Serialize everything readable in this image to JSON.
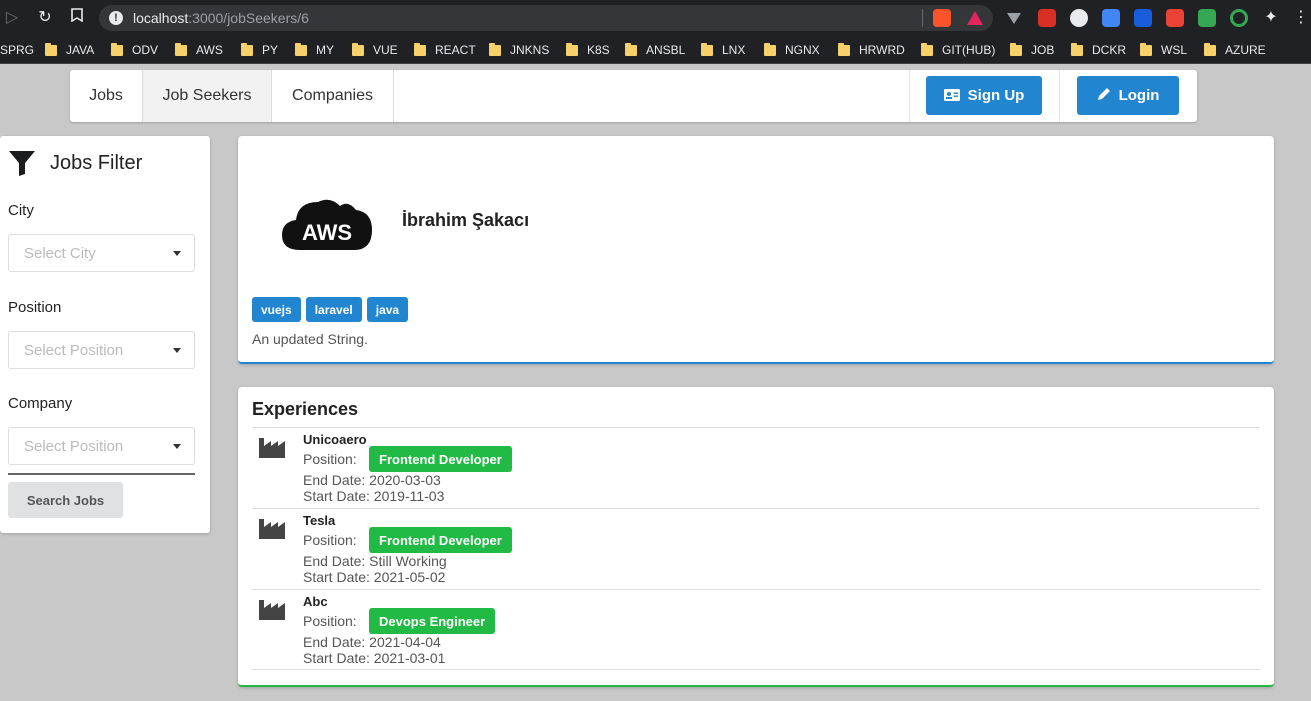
{
  "browser": {
    "url_host": "localhost",
    "url_rest": ":3000/jobSeekers/6",
    "bookmarks": [
      "SPRG",
      "JAVA",
      "ODV",
      "AWS",
      "PY",
      "MY",
      "VUE",
      "REACT",
      "JNKNS",
      "K8S",
      "ANSBL",
      "LNX",
      "NGNX",
      "HRWRD",
      "GIT(HUB)",
      "JOB",
      "DCKR",
      "WSL",
      "AZURE"
    ]
  },
  "nav": {
    "items": [
      "Jobs",
      "Job Seekers",
      "Companies"
    ],
    "active": "Job Seekers",
    "signup": "Sign Up",
    "login": "Login"
  },
  "filter": {
    "title": "Jobs Filter",
    "city_label": "City",
    "city_placeholder": "Select City",
    "position_label": "Position",
    "position_placeholder": "Select Position",
    "company_label": "Company",
    "company_placeholder": "Select Position",
    "search": "Search Jobs"
  },
  "profile": {
    "logo_text": "AWS",
    "name": "İbrahim Şakacı",
    "tags": [
      "vuejs",
      "laravel",
      "java"
    ],
    "bio": "An updated String."
  },
  "experiences": {
    "title": "Experiences",
    "position_label": "Position:",
    "items": [
      {
        "company": "Unicoaero",
        "position": "Frontend Developer",
        "end": "End Date: 2020-03-03",
        "start": "Start Date: 2019-11-03"
      },
      {
        "company": "Tesla",
        "position": "Frontend Developer",
        "end": "End Date: Still Working",
        "start": "Start Date: 2021-05-02"
      },
      {
        "company": "Abc",
        "position": "Devops Engineer",
        "end": "End Date: 2021-04-04",
        "start": "Start Date: 2021-03-01"
      }
    ]
  },
  "colors": {
    "primary": "#2185d0",
    "success": "#21ba45",
    "page_bg": "#c8c8c8"
  }
}
